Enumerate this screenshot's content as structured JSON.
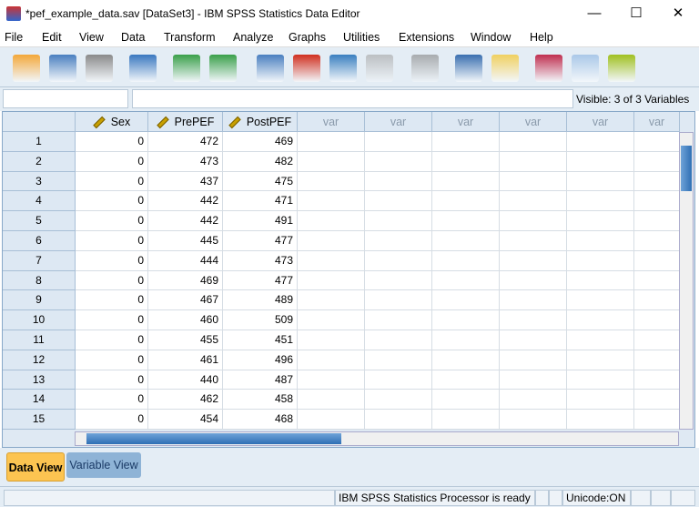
{
  "window": {
    "title": "*pef_example_data.sav [DataSet3] - IBM SPSS Statistics Data Editor",
    "minimize": "—",
    "maximize": "☐",
    "close": "✕"
  },
  "menu": [
    "File",
    "Edit",
    "View",
    "Data",
    "Transform",
    "Analyze",
    "Graphs",
    "Utilities",
    "Extensions",
    "Window",
    "Help"
  ],
  "toolbar": [
    "open-icon",
    "save-icon",
    "print-icon",
    "recall-dialog-icon",
    "undo-icon",
    "redo-icon",
    "goto-case-icon",
    "goto-variable-icon",
    "variables-icon",
    "run-descriptives-icon",
    "find-icon",
    "insert-cases-icon",
    "insert-variable-icon",
    "value-labels-icon",
    "use-variable-sets-icon",
    "spell-check-icon"
  ],
  "visible_vars": "Visible: 3 of 3 Variables",
  "columns": [
    "Sex",
    "PrePEF",
    "PostPEF",
    "var",
    "var",
    "var",
    "var",
    "var",
    "var"
  ],
  "rows": [
    {
      "n": "1",
      "v": [
        "0",
        "472",
        "469"
      ]
    },
    {
      "n": "2",
      "v": [
        "0",
        "473",
        "482"
      ]
    },
    {
      "n": "3",
      "v": [
        "0",
        "437",
        "475"
      ]
    },
    {
      "n": "4",
      "v": [
        "0",
        "442",
        "471"
      ]
    },
    {
      "n": "5",
      "v": [
        "0",
        "442",
        "491"
      ]
    },
    {
      "n": "6",
      "v": [
        "0",
        "445",
        "477"
      ]
    },
    {
      "n": "7",
      "v": [
        "0",
        "444",
        "473"
      ]
    },
    {
      "n": "8",
      "v": [
        "0",
        "469",
        "477"
      ]
    },
    {
      "n": "9",
      "v": [
        "0",
        "467",
        "489"
      ]
    },
    {
      "n": "10",
      "v": [
        "0",
        "460",
        "509"
      ]
    },
    {
      "n": "11",
      "v": [
        "0",
        "455",
        "451"
      ]
    },
    {
      "n": "12",
      "v": [
        "0",
        "461",
        "496"
      ]
    },
    {
      "n": "13",
      "v": [
        "0",
        "440",
        "487"
      ]
    },
    {
      "n": "14",
      "v": [
        "0",
        "462",
        "458"
      ]
    },
    {
      "n": "15",
      "v": [
        "0",
        "454",
        "468"
      ]
    }
  ],
  "tabs": {
    "data_view": "Data View",
    "variable_view": "Variable View"
  },
  "status": {
    "processor": "IBM SPSS Statistics Processor is ready",
    "unicode": "Unicode:ON"
  }
}
